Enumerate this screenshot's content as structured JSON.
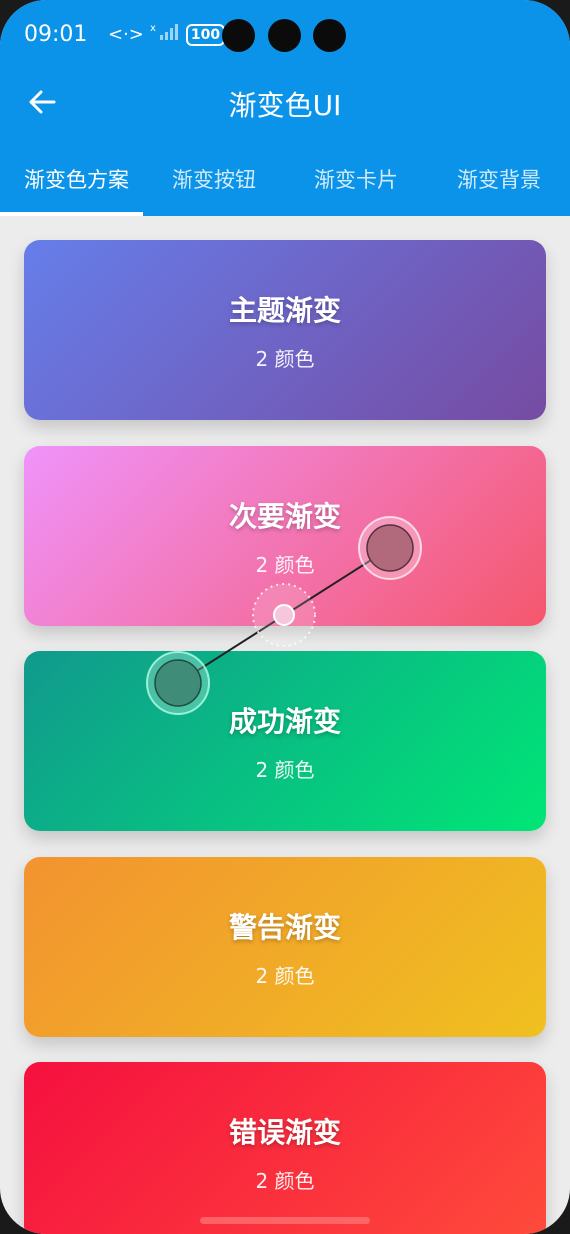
{
  "status_bar": {
    "time": "09:01",
    "signal_text": "<·>",
    "battery": "100"
  },
  "app_bar": {
    "title": "渐变色UI",
    "back_icon": "arrow-left-icon",
    "background": "#0a93e8"
  },
  "tabs": [
    {
      "label": "渐变色方案",
      "active": true
    },
    {
      "label": "渐变按钮",
      "active": false
    },
    {
      "label": "渐变卡片",
      "active": false
    },
    {
      "label": "渐变背景",
      "active": false
    }
  ],
  "cards": [
    {
      "title": "主题渐变",
      "subtitle": "2 颜色",
      "colors": [
        "#667eea",
        "#764ba2"
      ]
    },
    {
      "title": "次要渐变",
      "subtitle": "2 颜色",
      "colors": [
        "#f093fb",
        "#f5576c"
      ]
    },
    {
      "title": "成功渐变",
      "subtitle": "2 颜色",
      "colors": [
        "#11998e",
        "#00e676"
      ]
    },
    {
      "title": "警告渐变",
      "subtitle": "2 颜色",
      "colors": [
        "#f29330",
        "#f0c020"
      ]
    },
    {
      "title": "错误渐变",
      "subtitle": "2 颜色",
      "colors": [
        "#f5103f",
        "#ff4b3b"
      ]
    }
  ]
}
